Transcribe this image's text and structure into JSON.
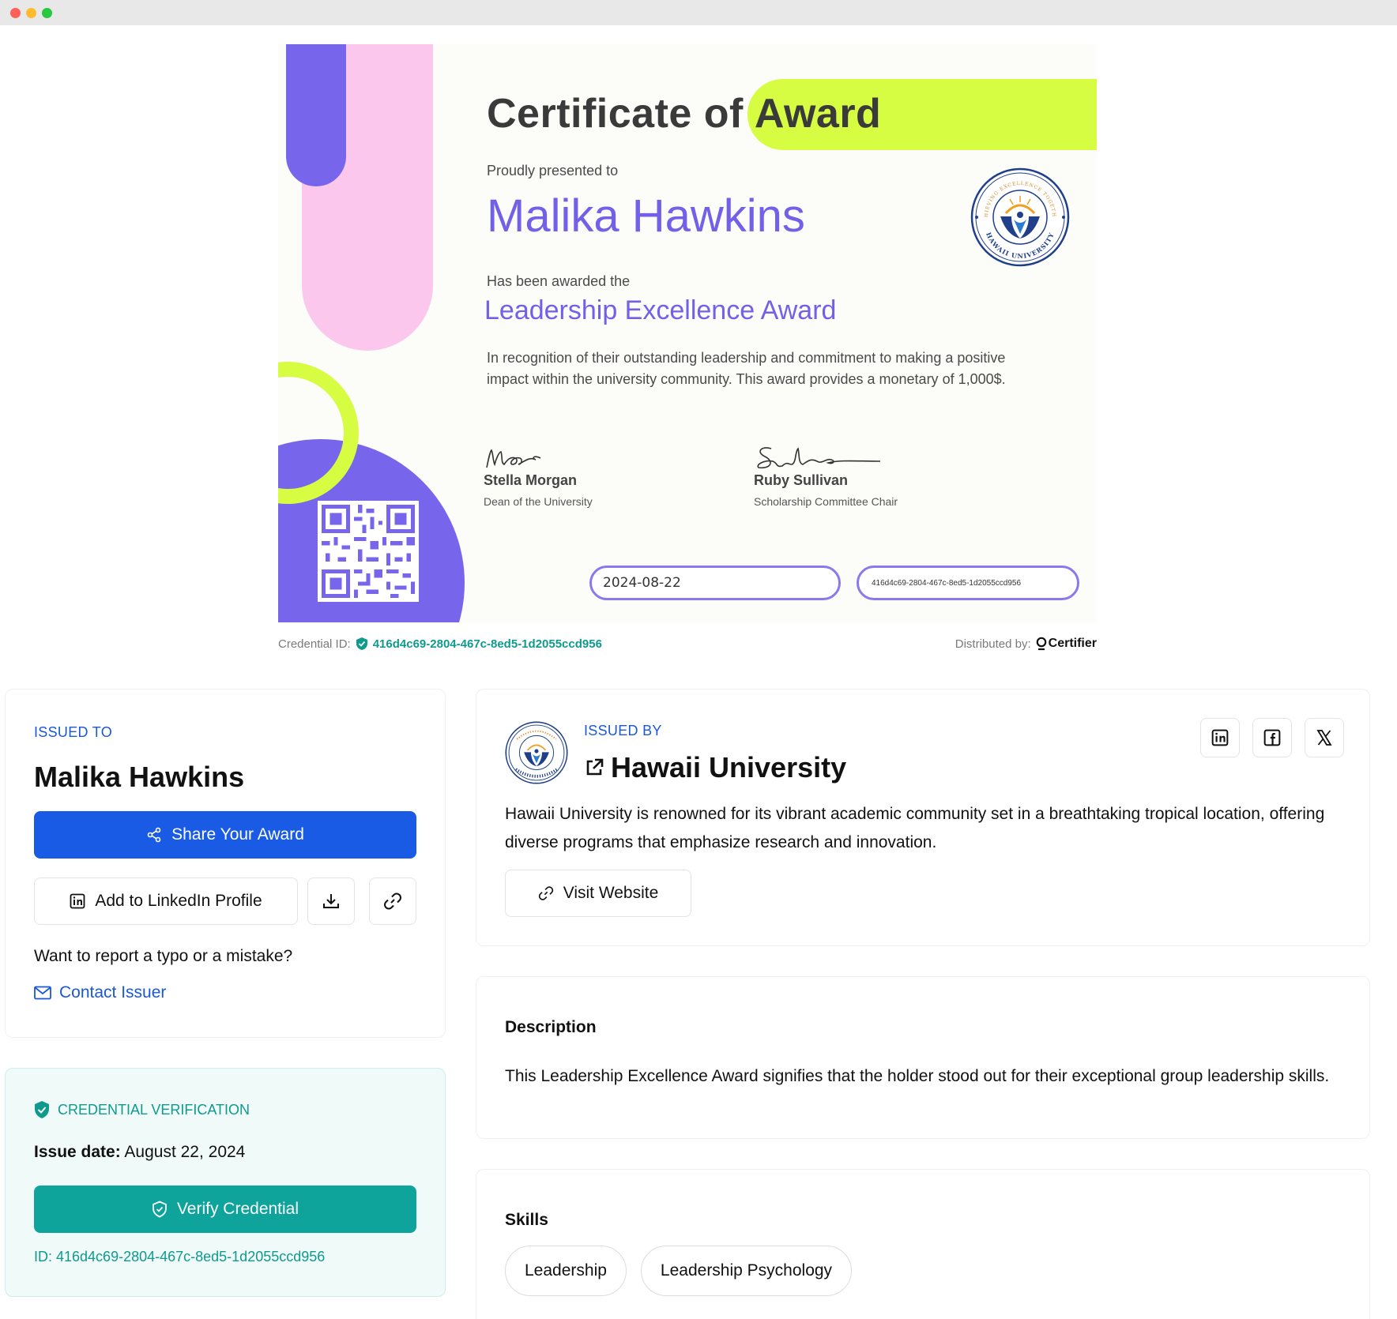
{
  "certificate": {
    "title_part1": "Certificate of",
    "title_part2": "Award",
    "presented_label": "Proudly presented to",
    "recipient_name": "Malika Hawkins",
    "awarded_label": "Has been awarded the",
    "award_name": "Leadership Excellence Award",
    "recognition_text": "In recognition of their outstanding leadership and commitment to making a positive impact within the university community. This award provides a monetary of 1,000$.",
    "signatories": [
      {
        "name": "Stella Morgan",
        "role": "Dean of the University"
      },
      {
        "name": "Ruby Sullivan",
        "role": "Scholarship Committee Chair"
      }
    ],
    "date_field": "2024-08-22",
    "id_field": "416d4c69-2804-467c-8ed5-1d2055ccd956",
    "colors": {
      "purple": "#7765ec",
      "pink": "#fbc7ec",
      "lime": "#d6fd42",
      "text_purple": "#7360e8"
    }
  },
  "footer": {
    "credential_label": "Credential ID:",
    "credential_id": "416d4c69-2804-467c-8ed5-1d2055ccd956",
    "distributed_label": "Distributed by:",
    "brand": "Certifier"
  },
  "issued_to": {
    "eyebrow": "ISSUED TO",
    "name": "Malika Hawkins",
    "share_label": "Share Your Award",
    "linkedin_label": "Add to LinkedIn Profile",
    "report_text": "Want to report a typo or a mistake?",
    "contact_label": "Contact Issuer"
  },
  "verification": {
    "eyebrow": "CREDENTIAL VERIFICATION",
    "issue_date_label": "Issue date:",
    "issue_date_value": "August 22, 2024",
    "verify_label": "Verify Credential",
    "id_text": "ID: 416d4c69-2804-467c-8ed5-1d2055ccd956"
  },
  "issuer": {
    "eyebrow": "ISSUED BY",
    "name": "Hawaii University",
    "description": "Hawaii University is renowned for its vibrant academic community set in a breathtaking tropical location, offering diverse programs that emphasize research and innovation.",
    "visit_label": "Visit Website",
    "seal_top_text": "ACHIEVING EXCELLENCE TOGETHER",
    "seal_bottom_text": "HAWAII UNIVERSITY"
  },
  "description": {
    "title": "Description",
    "text": "This Leadership Excellence Award signifies that the holder stood out for their exceptional group leadership skills."
  },
  "skills": {
    "title": "Skills",
    "items": [
      "Leadership",
      "Leadership Psychology"
    ]
  },
  "icons": {
    "share": "share-icon",
    "linkedin": "linkedin-icon",
    "download": "download-icon",
    "link": "link-icon",
    "mail": "mail-icon",
    "shield": "shield-check-icon",
    "external": "external-link-icon",
    "facebook": "facebook-icon",
    "x": "x-icon"
  },
  "accent": {
    "blue": "#1a5be6",
    "teal": "#0ea39b"
  }
}
